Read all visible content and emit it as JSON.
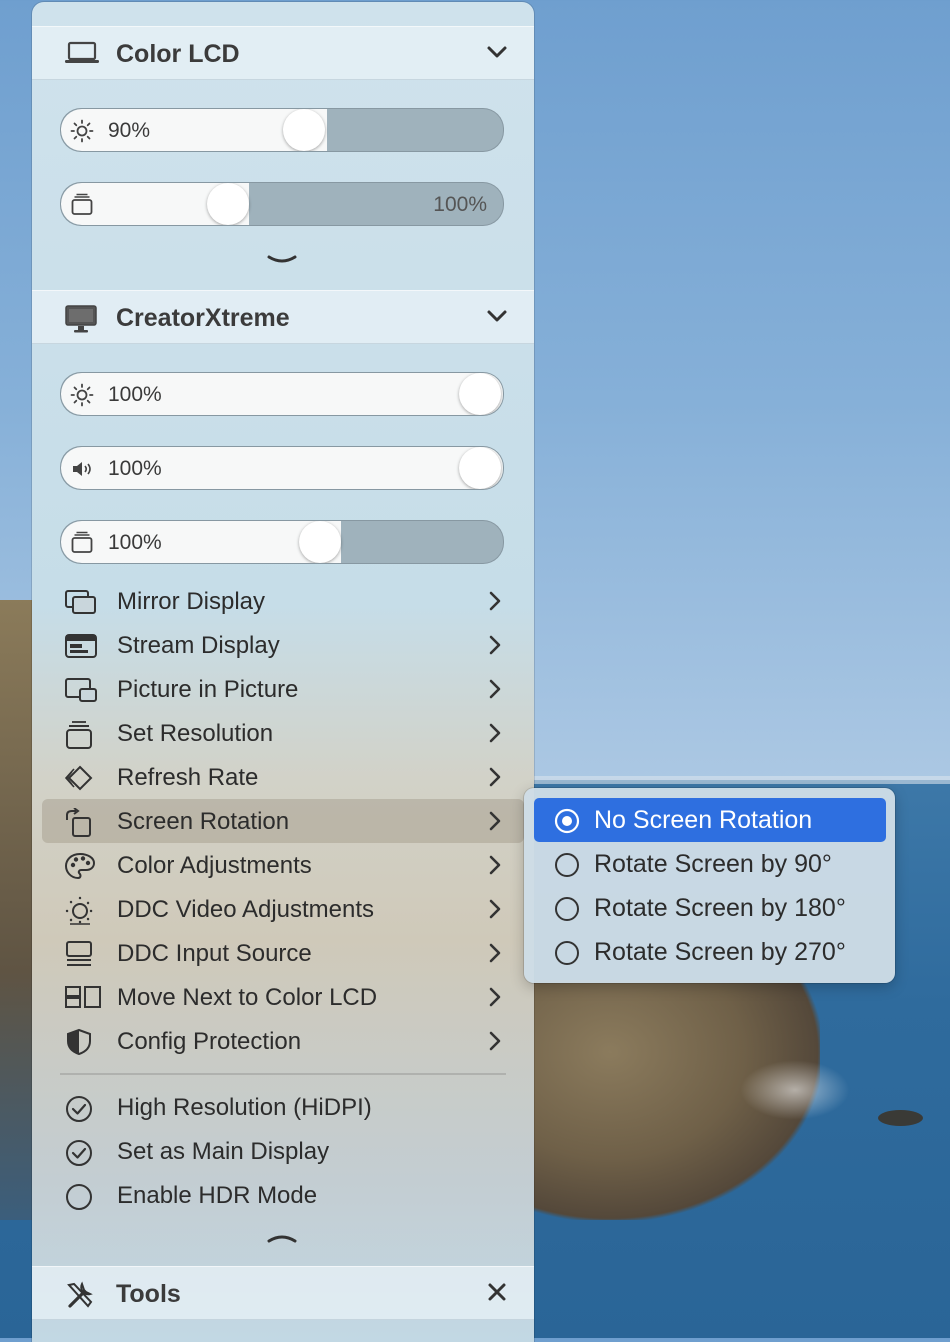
{
  "displays": [
    {
      "name": "Color LCD",
      "icon": "laptop-icon",
      "sliders": [
        {
          "icon": "brightness-icon",
          "value_text": "90%",
          "level": 0.57,
          "text_side": "left"
        },
        {
          "icon": "contrast-icon",
          "value_text": "100%",
          "level": 0.38,
          "text_side": "right"
        }
      ]
    },
    {
      "name": "CreatorXtreme",
      "icon": "monitor-icon",
      "sliders": [
        {
          "icon": "brightness-icon",
          "value_text": "100%",
          "level": 1.0
        },
        {
          "icon": "volume-icon",
          "value_text": "100%",
          "level": 1.0
        },
        {
          "icon": "contrast-icon",
          "value_text": "100%",
          "level": 0.63
        }
      ]
    }
  ],
  "menu_items": [
    {
      "label": "Mirror Display",
      "icon": "mirror-display-icon"
    },
    {
      "label": "Stream Display",
      "icon": "stream-display-icon"
    },
    {
      "label": "Picture in Picture",
      "icon": "picture-in-picture-icon"
    },
    {
      "label": "Set Resolution",
      "icon": "resolution-icon"
    },
    {
      "label": "Refresh Rate",
      "icon": "refresh-rate-icon"
    },
    {
      "label": "Screen Rotation",
      "icon": "rotate-icon",
      "highlighted": true
    },
    {
      "label": "Color Adjustments",
      "icon": "palette-icon"
    },
    {
      "label": "DDC Video Adjustments",
      "icon": "video-adjust-icon"
    },
    {
      "label": "DDC Input Source",
      "icon": "input-source-icon"
    },
    {
      "label": "Move Next to Color LCD",
      "icon": "arrange-icon"
    },
    {
      "label": "Config Protection",
      "icon": "shield-icon"
    }
  ],
  "toggle_items": [
    {
      "label": "High Resolution (HiDPI)",
      "checked": true
    },
    {
      "label": "Set as Main Display",
      "checked": true
    },
    {
      "label": "Enable HDR Mode",
      "checked": false
    }
  ],
  "tools": {
    "title": "Tools"
  },
  "submenu": {
    "items": [
      {
        "label": "No Screen Rotation",
        "selected": true
      },
      {
        "label": "Rotate Screen by 90°",
        "selected": false
      },
      {
        "label": "Rotate Screen by 180°",
        "selected": false
      },
      {
        "label": "Rotate Screen by 270°",
        "selected": false
      }
    ]
  },
  "colors": {
    "selection": "#2e6fe0",
    "text": "#2c2c2c"
  }
}
